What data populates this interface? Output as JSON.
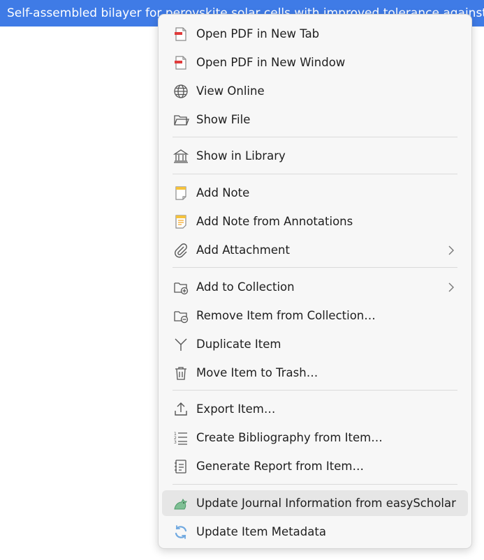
{
  "selected_item": {
    "title": "Self-assembled bilayer for perovskite solar cells with improved tolerance against"
  },
  "context_menu": {
    "items": [
      {
        "label": "Open PDF in New Tab",
        "icon": "pdf-icon"
      },
      {
        "label": "Open PDF in New Window",
        "icon": "pdf-icon"
      },
      {
        "label": "View Online",
        "icon": "globe-icon"
      },
      {
        "label": "Show File",
        "icon": "folder-icon"
      },
      {
        "label": "Show in Library",
        "icon": "library-icon"
      },
      {
        "label": "Add Note",
        "icon": "note-icon"
      },
      {
        "label": "Add Note from Annotations",
        "icon": "note-annotations-icon"
      },
      {
        "label": "Add Attachment",
        "icon": "paperclip-icon",
        "submenu": true
      },
      {
        "label": "Add to Collection",
        "icon": "folder-add-icon",
        "submenu": true
      },
      {
        "label": "Remove Item from Collection…",
        "icon": "folder-remove-icon"
      },
      {
        "label": "Duplicate Item",
        "icon": "duplicate-icon"
      },
      {
        "label": "Move Item to Trash…",
        "icon": "trash-icon"
      },
      {
        "label": "Export Item…",
        "icon": "export-icon"
      },
      {
        "label": "Create Bibliography from Item…",
        "icon": "bibliography-icon"
      },
      {
        "label": "Generate Report from Item…",
        "icon": "report-icon"
      },
      {
        "label": "Update Journal Information from easyScholar",
        "icon": "easyscholar-icon",
        "highlighted": true
      },
      {
        "label": "Update Item Metadata",
        "icon": "refresh-icon"
      }
    ]
  },
  "colors": {
    "selection": "#3f7be6",
    "menu_background": "#f7f7f7",
    "hover": "#e6e6e6",
    "pdf_red": "#e03b3b",
    "note_yellow": "#f5c23b",
    "easyscholar_green": "#4e9b6a",
    "refresh_blue": "#6fa8e0"
  }
}
